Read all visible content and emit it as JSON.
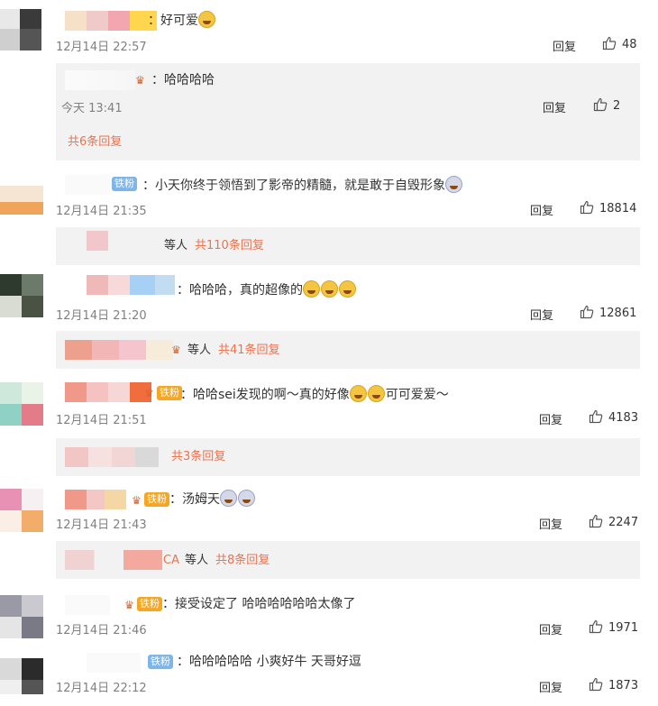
{
  "comments": [
    {
      "text": "好可爱",
      "time": "12月14日 22:57",
      "reply_label": "回复",
      "likes": "48",
      "sub_reply": {
        "text": "哈哈哈哈",
        "time": "今天 13:41",
        "reply_label": "回复",
        "likes": "2"
      },
      "more_replies": "共6条回复"
    },
    {
      "badge": "铁粉",
      "text": "小天你终于领悟到了影帝的精髓，就是敢于自毁形象",
      "time": "12月14日 21:35",
      "reply_label": "回复",
      "likes": "18814",
      "replies_prefix": "等人",
      "more_replies": "共110条回复"
    },
    {
      "text": "哈哈哈，真的超像的",
      "time": "12月14日 21:20",
      "reply_label": "回复",
      "likes": "12861",
      "replies_prefix": "等人",
      "more_replies": "共41条回复"
    },
    {
      "badge": "铁粉",
      "text_before": "哈哈sei发现的啊～真的好像",
      "text_after": "可可爱爱～",
      "time": "12月14日 21:51",
      "reply_label": "回复",
      "likes": "4183",
      "more_replies": "共3条回复"
    },
    {
      "badge": "铁粉",
      "text": "汤姆天",
      "time": "12月14日 21:43",
      "reply_label": "回复",
      "likes": "2247",
      "replies_name": "CA",
      "replies_prefix": "等人",
      "more_replies": "共8条回复"
    },
    {
      "badge": "铁粉",
      "text": "接受设定了 哈哈哈哈哈哈太像了",
      "time": "12月14日 21:46",
      "reply_label": "回复",
      "likes": "1971"
    },
    {
      "badge": "铁粉",
      "text": "哈哈哈哈哈  小爽好牛  天哥好逗",
      "time": "12月14日 22:12",
      "reply_label": "回复",
      "likes": "1873"
    }
  ],
  "colors": {
    "link": "#eb7350",
    "time": "#808080",
    "sub_bg": "#f2f2f2",
    "badge_gold": "#f5a623",
    "badge_blue": "#7fb6ea"
  }
}
